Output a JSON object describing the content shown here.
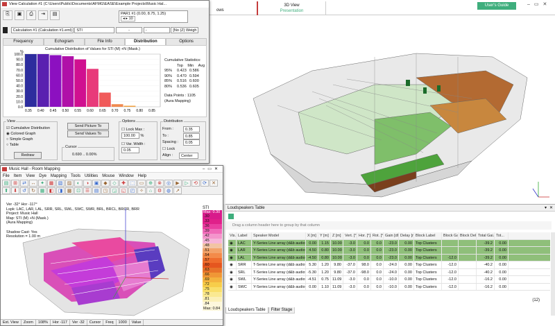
{
  "app": {
    "title_tab": "ows",
    "view_tab": "3D View",
    "presentation_tab": "Presentation",
    "users_guide": "User's Guide"
  },
  "colors": {
    "accent_green": "#3fae7d",
    "accent_red": "#c43c3c",
    "row_green": "#8fbf7a"
  },
  "calc_window": {
    "title": "View Calculation #1 (C:\\Users\\Public\\Documents\\AFMG\\EASE\\Example Projects\\Music Hal...",
    "par_label": "PAR1 #1",
    "par_coords": "(0.00, 8.75, 1.25)",
    "par_value": "10",
    "calc_select": "Calculation #1 (Calculation #1.eml)",
    "map_select": "STI",
    "dash_select": "-",
    "dash_select2": "-",
    "weight_select": "[No (Z) Weigh",
    "tabs": [
      "Frequency",
      "Echogram",
      "File Info",
      "Distribution",
      "Options"
    ],
    "chart_title": "Cumulative Distribution of Values for STI (M) +N (Mask.)",
    "stats": {
      "title": "Cumulative Statistics:",
      "headers": [
        "Top",
        "Min",
        "Avg"
      ],
      "rows": [
        [
          "95%",
          "0.423",
          "0.586"
        ],
        [
          "90%",
          "0.470",
          "0.594"
        ],
        [
          "85%",
          "0.516",
          "0.600"
        ],
        [
          "80%",
          "0.536",
          "0.605"
        ]
      ],
      "data_points": "Data Points : 1105",
      "aura": "(Aura Mapping)"
    },
    "view_group": {
      "label": "View",
      "cumulative": "Cumulative Distribution",
      "colored": "Colored Graph",
      "simple": "Simple Graph",
      "table": "Table",
      "redraw": "Redraw"
    },
    "send_picture": "Send Picture To",
    "send_values": "Send Values To",
    "cursor_label": "Cursor",
    "cursor_value": "0.690 .. 0.00%",
    "options_group": {
      "label": "Options",
      "lock_max": "Lock Max :",
      "lock_max_value": "100.00",
      "percent": "%",
      "var_width": "Var. Width :",
      "var_width_value": "0.05"
    },
    "distribution_group": {
      "label": "Distribution",
      "from_label": "From :",
      "from_value": "0.35",
      "to_label": "To :",
      "to_value": "0.85",
      "spacing_label": "Spacing :",
      "spacing_value": "0.05",
      "lock": "Lock",
      "align_label": "Align :",
      "align_value": "Center"
    }
  },
  "chart_data": {
    "type": "bar",
    "title": "Cumulative Distribution of Values for STI (M) +N (Mask.)",
    "ylabel": "%",
    "categories": [
      "0.35",
      "0.40",
      "0.45",
      "0.50",
      "0.55",
      "0.60",
      "0.65",
      "0.70",
      "0.75",
      "0.80",
      "0.85"
    ],
    "values": [
      100,
      100,
      98,
      96,
      90,
      72,
      27,
      5,
      2,
      0,
      0
    ],
    "yticks": [
      "100.0",
      "90.0",
      "80.0",
      "70.0",
      "60.0",
      "50.0",
      "40.0",
      "30.0",
      "20.0",
      "10.0",
      "0.0"
    ],
    "ylim": [
      0,
      100
    ],
    "bar_colors": [
      "#2d2d9e",
      "#5a20b0",
      "#8c10c0",
      "#b010a8",
      "#d01090",
      "#e83a7a",
      "#f05a5a",
      "#f08a50",
      "#f0a040",
      "#f0b030",
      "#f0c020"
    ]
  },
  "room_window": {
    "title": "Music Hall - Room Mapping",
    "menu": [
      "File",
      "Item",
      "View",
      "Dye",
      "Mapping",
      "Tools",
      "Utilities",
      "Mouse",
      "Window",
      "Help"
    ],
    "info_lines": [
      "Ver -32°  Hor -117°",
      "Lspk: LAC, LAR, LAL, SRR, SRL, SWL, SWC, SWR, BRL, BRCL, BRCR, BRR",
      "Project: Music Hall",
      "Map: STI (M) +N (Mask.)",
      "(Aura Mapping)",
      "",
      "Shadow Cast: Yes",
      "Resolution = 1.00 m"
    ],
    "legend_title": "STI",
    "legend_max": "Max: 0.30",
    "legend_values": [
      ".30",
      ".33",
      ".36",
      ".39",
      ".42",
      ".45",
      ".48",
      ".51",
      ".54",
      ".57",
      ".60",
      ".63",
      ".66",
      ".69",
      ".72",
      ".75",
      ".78",
      ".81",
      ".84"
    ],
    "legend_min": "Max: 0.84",
    "status": [
      "Ext. View",
      "Zoom",
      "108%",
      "Hor -117",
      "Ver -32",
      "Cursor",
      "Freq",
      "1000",
      "Value"
    ]
  },
  "ls_table": {
    "title": "Loudspeakers Table",
    "group_hint": "Drag a column header here to group by that column",
    "columns": [
      "Vis.",
      "Label",
      "Speaker Model",
      "X [m]",
      "Y [m]",
      "Z [m]",
      "Vert. [°]",
      "Hor. [°]",
      "Rot. [°]",
      "Gain [dB]",
      "Delay [ms]",
      "Block Label",
      "Block Ga...",
      "Block Delay...",
      "Total Gai...",
      "Tot..."
    ],
    "rows": [
      {
        "label": "LAC",
        "model": "Y-Series Line array (d&b audiotechnik)",
        "x": "0.00",
        "y": "1.15",
        "z": "10.00",
        "vert": "-3.0",
        "hor": "0.0",
        "rot": "0.0",
        "gain": "-23.0",
        "delay": "0.00",
        "block": "Top Clusters",
        "bgain": "",
        "bdelay": "",
        "total": "-39.2",
        "tot": "0.00",
        "green": true
      },
      {
        "label": "LAR",
        "model": "Y-Series Line array (d&b audiotechnik)",
        "x": "4.50",
        "y": "0.80",
        "z": "10.00",
        "vert": "-3.0",
        "hor": "0.0",
        "rot": "0.0",
        "gain": "-23.0",
        "delay": "0.00",
        "block": "Top Clusters",
        "bgain": "",
        "bdelay": "",
        "total": "-39.2",
        "tot": "0.00",
        "green": true
      },
      {
        "label": "LAL",
        "model": "Y-Series Line array (d&b audiotechnik)",
        "x": "-4.50",
        "y": "0.80",
        "z": "10.00",
        "vert": "-3.0",
        "hor": "0.0",
        "rot": "0.0",
        "gain": "-23.0",
        "delay": "0.00",
        "block": "Top Clusters",
        "bgain": "-12.0",
        "bdelay": "",
        "total": "-39.2",
        "tot": "0.00",
        "green": true
      },
      {
        "label": "SRR",
        "model": "T-Series Line array (d&b audiotechnik)",
        "x": "5.30",
        "y": "1.20",
        "z": "9.80",
        "vert": "-37.0",
        "hor": "98.0",
        "rot": "0.0",
        "gain": "-24.0",
        "delay": "0.00",
        "block": "Top Clusters",
        "bgain": "-12.0",
        "bdelay": "",
        "total": "-40.2",
        "tot": "0.00",
        "green": false
      },
      {
        "label": "SRL",
        "model": "T-Series Line array (d&b audiotechnik)",
        "x": "-5.30",
        "y": "1.20",
        "z": "9.80",
        "vert": "-37.0",
        "hor": "-98.0",
        "rot": "0.0",
        "gain": "-24.0",
        "delay": "0.00",
        "block": "Top Clusters",
        "bgain": "-12.0",
        "bdelay": "",
        "total": "-40.2",
        "tot": "0.00",
        "green": false
      },
      {
        "label": "SWL",
        "model": "Y-Series Line array (d&b audiotechnik)",
        "x": "-4.51",
        "y": "0.75",
        "z": "11.09",
        "vert": "-3.0",
        "hor": "0.0",
        "rot": "0.0",
        "gain": "-10.0",
        "delay": "0.00",
        "block": "Top Clusters",
        "bgain": "-12.0",
        "bdelay": "",
        "total": "-16.2",
        "tot": "0.00",
        "green": false
      },
      {
        "label": "SWC",
        "model": "Y-Series Line array (d&b audiotechnik)",
        "x": "0.00",
        "y": "1.10",
        "z": "11.09",
        "vert": "-3.0",
        "hor": "0.0",
        "rot": "0.0",
        "gain": "-10.0",
        "delay": "0.00",
        "block": "Top Clusters",
        "bgain": "-12.0",
        "bdelay": "",
        "total": "-16.2",
        "tot": "0.00",
        "green": false
      }
    ],
    "count": "(12)",
    "tabs": [
      "Loudspeakers Table",
      "Filter Stage"
    ]
  }
}
